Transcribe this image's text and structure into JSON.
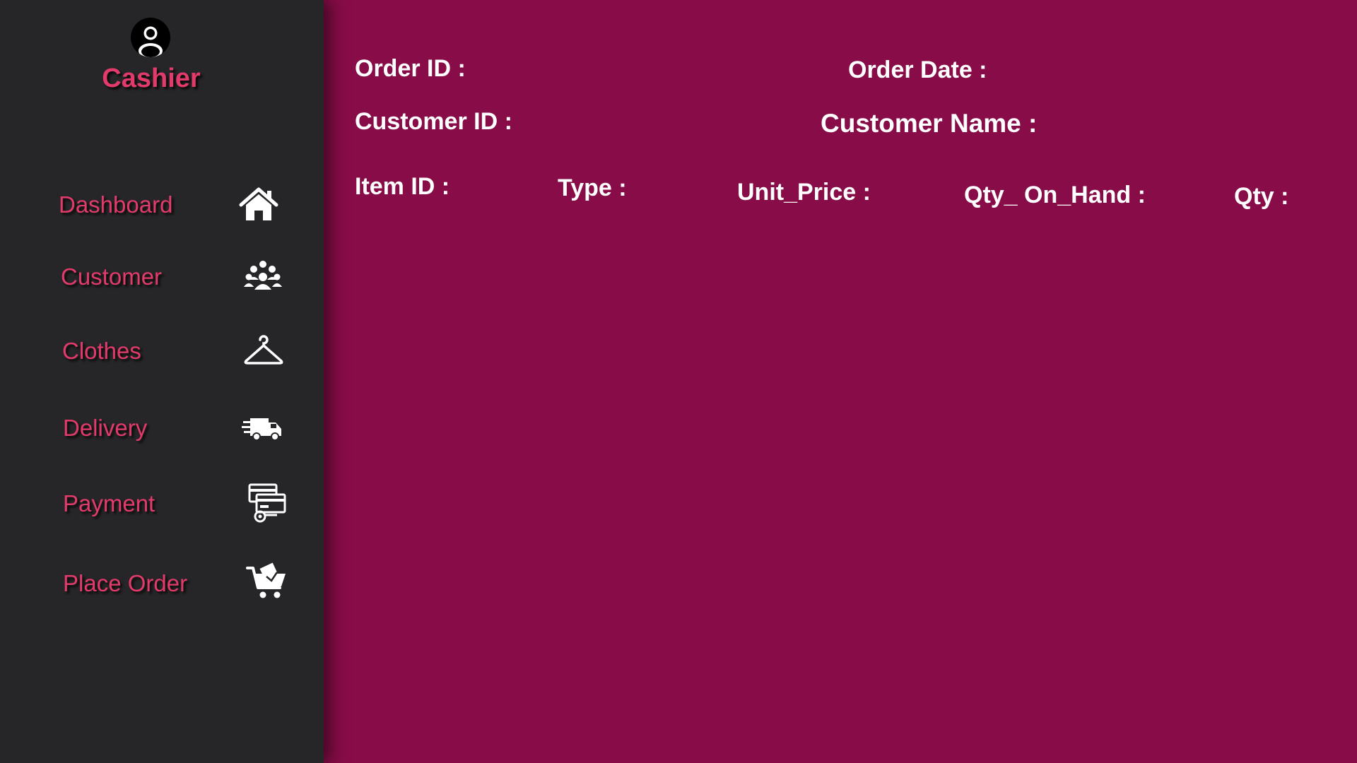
{
  "sidebar": {
    "user_icon": "user-avatar-icon",
    "role": "Cashier",
    "items": [
      {
        "label": "Dashboard",
        "icon": "home-icon"
      },
      {
        "label": "Customer",
        "icon": "people-group-icon"
      },
      {
        "label": "Clothes",
        "icon": "hanger-icon"
      },
      {
        "label": "Delivery",
        "icon": "delivery-truck-icon"
      },
      {
        "label": "Payment",
        "icon": "payment-card-icon"
      },
      {
        "label": "Place Order",
        "icon": "shopping-cart-icon"
      }
    ]
  },
  "form": {
    "order_id_label": "Order ID :",
    "order_date_label": "Order Date :",
    "customer_id_label": "Customer ID :",
    "customer_name_label": "Customer Name :",
    "item_id_label": "Item ID :",
    "type_label": "Type :",
    "unit_price_label": "Unit_Price :",
    "qty_on_hand_label": "Qty_ On_Hand :",
    "qty_label": "Qty :"
  },
  "colors": {
    "sidebar_bg": "#262628",
    "main_bg": "#870c47",
    "accent": "#e23a6b",
    "text": "#ffffff"
  }
}
